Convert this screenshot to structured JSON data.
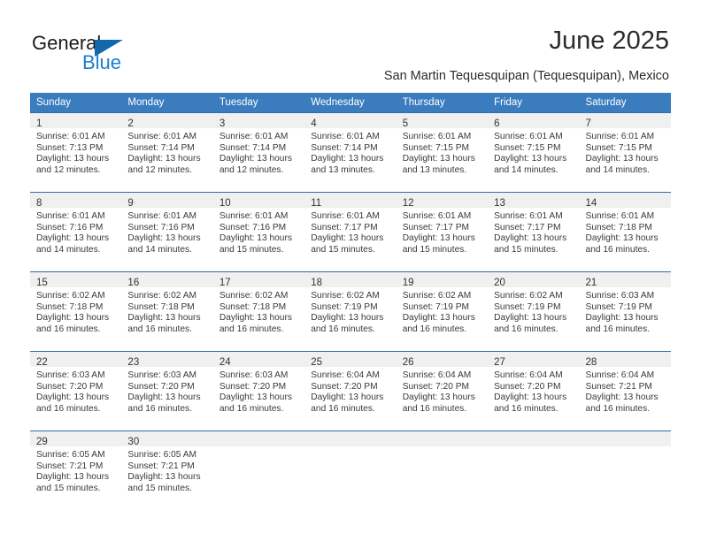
{
  "logo": {
    "word1": "General",
    "word2": "Blue",
    "triangle_color": "#1368ad",
    "blue_color": "#1a7fd4"
  },
  "header": {
    "title": "June 2025",
    "subtitle": "San Martin Tequesquipan (Tequesquipan), Mexico"
  },
  "theme": {
    "header_bg": "#3a7cbe",
    "row_divider": "#2f6fae",
    "daynum_band": "#f0f0f0"
  },
  "calendar": {
    "weekday_headers": [
      "Sunday",
      "Monday",
      "Tuesday",
      "Wednesday",
      "Thursday",
      "Friday",
      "Saturday"
    ],
    "weeks": [
      [
        {
          "day": "1",
          "sunrise": "Sunrise: 6:01 AM",
          "sunset": "Sunset: 7:13 PM",
          "daylight1": "Daylight: 13 hours",
          "daylight2": "and 12 minutes."
        },
        {
          "day": "2",
          "sunrise": "Sunrise: 6:01 AM",
          "sunset": "Sunset: 7:14 PM",
          "daylight1": "Daylight: 13 hours",
          "daylight2": "and 12 minutes."
        },
        {
          "day": "3",
          "sunrise": "Sunrise: 6:01 AM",
          "sunset": "Sunset: 7:14 PM",
          "daylight1": "Daylight: 13 hours",
          "daylight2": "and 12 minutes."
        },
        {
          "day": "4",
          "sunrise": "Sunrise: 6:01 AM",
          "sunset": "Sunset: 7:14 PM",
          "daylight1": "Daylight: 13 hours",
          "daylight2": "and 13 minutes."
        },
        {
          "day": "5",
          "sunrise": "Sunrise: 6:01 AM",
          "sunset": "Sunset: 7:15 PM",
          "daylight1": "Daylight: 13 hours",
          "daylight2": "and 13 minutes."
        },
        {
          "day": "6",
          "sunrise": "Sunrise: 6:01 AM",
          "sunset": "Sunset: 7:15 PM",
          "daylight1": "Daylight: 13 hours",
          "daylight2": "and 14 minutes."
        },
        {
          "day": "7",
          "sunrise": "Sunrise: 6:01 AM",
          "sunset": "Sunset: 7:15 PM",
          "daylight1": "Daylight: 13 hours",
          "daylight2": "and 14 minutes."
        }
      ],
      [
        {
          "day": "8",
          "sunrise": "Sunrise: 6:01 AM",
          "sunset": "Sunset: 7:16 PM",
          "daylight1": "Daylight: 13 hours",
          "daylight2": "and 14 minutes."
        },
        {
          "day": "9",
          "sunrise": "Sunrise: 6:01 AM",
          "sunset": "Sunset: 7:16 PM",
          "daylight1": "Daylight: 13 hours",
          "daylight2": "and 14 minutes."
        },
        {
          "day": "10",
          "sunrise": "Sunrise: 6:01 AM",
          "sunset": "Sunset: 7:16 PM",
          "daylight1": "Daylight: 13 hours",
          "daylight2": "and 15 minutes."
        },
        {
          "day": "11",
          "sunrise": "Sunrise: 6:01 AM",
          "sunset": "Sunset: 7:17 PM",
          "daylight1": "Daylight: 13 hours",
          "daylight2": "and 15 minutes."
        },
        {
          "day": "12",
          "sunrise": "Sunrise: 6:01 AM",
          "sunset": "Sunset: 7:17 PM",
          "daylight1": "Daylight: 13 hours",
          "daylight2": "and 15 minutes."
        },
        {
          "day": "13",
          "sunrise": "Sunrise: 6:01 AM",
          "sunset": "Sunset: 7:17 PM",
          "daylight1": "Daylight: 13 hours",
          "daylight2": "and 15 minutes."
        },
        {
          "day": "14",
          "sunrise": "Sunrise: 6:01 AM",
          "sunset": "Sunset: 7:18 PM",
          "daylight1": "Daylight: 13 hours",
          "daylight2": "and 16 minutes."
        }
      ],
      [
        {
          "day": "15",
          "sunrise": "Sunrise: 6:02 AM",
          "sunset": "Sunset: 7:18 PM",
          "daylight1": "Daylight: 13 hours",
          "daylight2": "and 16 minutes."
        },
        {
          "day": "16",
          "sunrise": "Sunrise: 6:02 AM",
          "sunset": "Sunset: 7:18 PM",
          "daylight1": "Daylight: 13 hours",
          "daylight2": "and 16 minutes."
        },
        {
          "day": "17",
          "sunrise": "Sunrise: 6:02 AM",
          "sunset": "Sunset: 7:18 PM",
          "daylight1": "Daylight: 13 hours",
          "daylight2": "and 16 minutes."
        },
        {
          "day": "18",
          "sunrise": "Sunrise: 6:02 AM",
          "sunset": "Sunset: 7:19 PM",
          "daylight1": "Daylight: 13 hours",
          "daylight2": "and 16 minutes."
        },
        {
          "day": "19",
          "sunrise": "Sunrise: 6:02 AM",
          "sunset": "Sunset: 7:19 PM",
          "daylight1": "Daylight: 13 hours",
          "daylight2": "and 16 minutes."
        },
        {
          "day": "20",
          "sunrise": "Sunrise: 6:02 AM",
          "sunset": "Sunset: 7:19 PM",
          "daylight1": "Daylight: 13 hours",
          "daylight2": "and 16 minutes."
        },
        {
          "day": "21",
          "sunrise": "Sunrise: 6:03 AM",
          "sunset": "Sunset: 7:19 PM",
          "daylight1": "Daylight: 13 hours",
          "daylight2": "and 16 minutes."
        }
      ],
      [
        {
          "day": "22",
          "sunrise": "Sunrise: 6:03 AM",
          "sunset": "Sunset: 7:20 PM",
          "daylight1": "Daylight: 13 hours",
          "daylight2": "and 16 minutes."
        },
        {
          "day": "23",
          "sunrise": "Sunrise: 6:03 AM",
          "sunset": "Sunset: 7:20 PM",
          "daylight1": "Daylight: 13 hours",
          "daylight2": "and 16 minutes."
        },
        {
          "day": "24",
          "sunrise": "Sunrise: 6:03 AM",
          "sunset": "Sunset: 7:20 PM",
          "daylight1": "Daylight: 13 hours",
          "daylight2": "and 16 minutes."
        },
        {
          "day": "25",
          "sunrise": "Sunrise: 6:04 AM",
          "sunset": "Sunset: 7:20 PM",
          "daylight1": "Daylight: 13 hours",
          "daylight2": "and 16 minutes."
        },
        {
          "day": "26",
          "sunrise": "Sunrise: 6:04 AM",
          "sunset": "Sunset: 7:20 PM",
          "daylight1": "Daylight: 13 hours",
          "daylight2": "and 16 minutes."
        },
        {
          "day": "27",
          "sunrise": "Sunrise: 6:04 AM",
          "sunset": "Sunset: 7:20 PM",
          "daylight1": "Daylight: 13 hours",
          "daylight2": "and 16 minutes."
        },
        {
          "day": "28",
          "sunrise": "Sunrise: 6:04 AM",
          "sunset": "Sunset: 7:21 PM",
          "daylight1": "Daylight: 13 hours",
          "daylight2": "and 16 minutes."
        }
      ],
      [
        {
          "day": "29",
          "sunrise": "Sunrise: 6:05 AM",
          "sunset": "Sunset: 7:21 PM",
          "daylight1": "Daylight: 13 hours",
          "daylight2": "and 15 minutes."
        },
        {
          "day": "30",
          "sunrise": "Sunrise: 6:05 AM",
          "sunset": "Sunset: 7:21 PM",
          "daylight1": "Daylight: 13 hours",
          "daylight2": "and 15 minutes."
        },
        {
          "day": "",
          "sunrise": "",
          "sunset": "",
          "daylight1": "",
          "daylight2": ""
        },
        {
          "day": "",
          "sunrise": "",
          "sunset": "",
          "daylight1": "",
          "daylight2": ""
        },
        {
          "day": "",
          "sunrise": "",
          "sunset": "",
          "daylight1": "",
          "daylight2": ""
        },
        {
          "day": "",
          "sunrise": "",
          "sunset": "",
          "daylight1": "",
          "daylight2": ""
        },
        {
          "day": "",
          "sunrise": "",
          "sunset": "",
          "daylight1": "",
          "daylight2": ""
        }
      ]
    ]
  }
}
